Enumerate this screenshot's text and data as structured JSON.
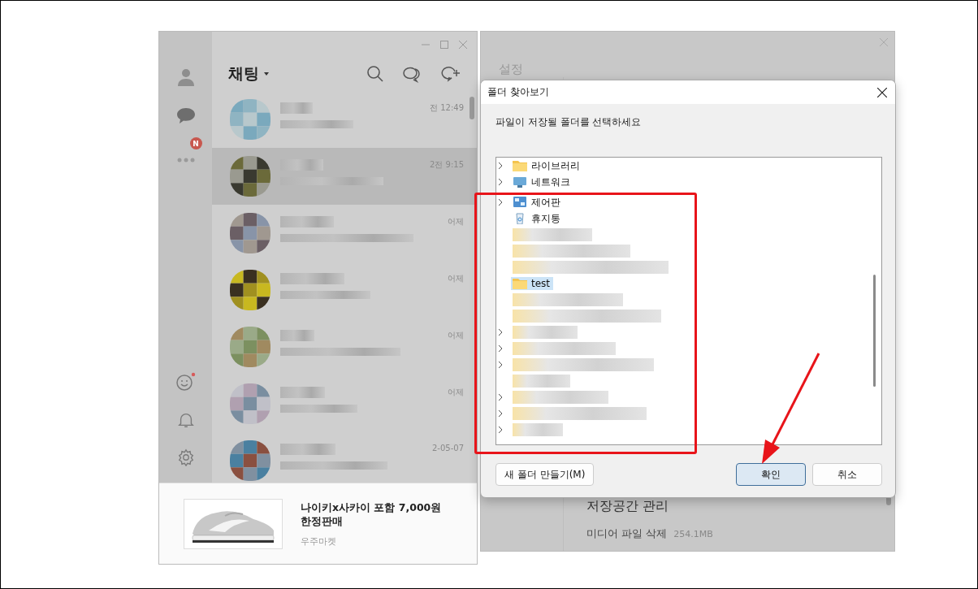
{
  "chat_window": {
    "title": "채팅",
    "more_badge": "N",
    "rows": [
      {
        "time": "전 12:49",
        "selected": false
      },
      {
        "time": "2전 9:15",
        "selected": true
      },
      {
        "time": "어제",
        "selected": false
      },
      {
        "time": "어제",
        "selected": false
      },
      {
        "time": "어제",
        "selected": false
      },
      {
        "time": "어제",
        "selected": false
      },
      {
        "time": "2-05-07",
        "selected": false
      }
    ],
    "ad": {
      "title": "나이키x사카이 포함 7,000원 한정판매",
      "source": "우주마켓"
    }
  },
  "settings_window": {
    "title": "설정",
    "section": "저장공간 관리",
    "item_label": "미디어 파일 삭제",
    "item_size": "254.1MB"
  },
  "dialog": {
    "title": "폴더 찾아보기",
    "prompt": "파일이 저장될 폴더를 선택하세요",
    "tree": [
      {
        "kind": "library",
        "label": "라이브러리",
        "expandable": true,
        "selected": false
      },
      {
        "kind": "network",
        "label": "네트워크",
        "expandable": true,
        "selected": false
      },
      {
        "kind": "control",
        "label": "제어판",
        "expandable": true,
        "selected": false
      },
      {
        "kind": "trash",
        "label": "휴지통",
        "expandable": false,
        "selected": false
      },
      {
        "kind": "redacted",
        "expandable": false,
        "selected": false
      },
      {
        "kind": "redacted",
        "expandable": false,
        "selected": false
      },
      {
        "kind": "redacted",
        "expandable": false,
        "selected": false
      },
      {
        "kind": "folder",
        "label": "test",
        "expandable": false,
        "selected": true
      },
      {
        "kind": "redacted",
        "expandable": false,
        "selected": false
      },
      {
        "kind": "redacted",
        "expandable": false,
        "selected": false
      },
      {
        "kind": "redacted",
        "expandable": true,
        "selected": false
      },
      {
        "kind": "redacted",
        "expandable": true,
        "selected": false
      },
      {
        "kind": "redacted",
        "expandable": true,
        "selected": false
      },
      {
        "kind": "redacted",
        "expandable": false,
        "selected": false
      },
      {
        "kind": "redacted",
        "expandable": true,
        "selected": false
      },
      {
        "kind": "redacted",
        "expandable": true,
        "selected": false
      },
      {
        "kind": "redacted",
        "expandable": true,
        "selected": false
      }
    ],
    "buttons": [
      {
        "label": "새 폴더 만들기(M)",
        "kind": "normal"
      },
      {
        "label": "확인",
        "kind": "default"
      },
      {
        "label": "취소",
        "kind": "normal"
      }
    ]
  }
}
